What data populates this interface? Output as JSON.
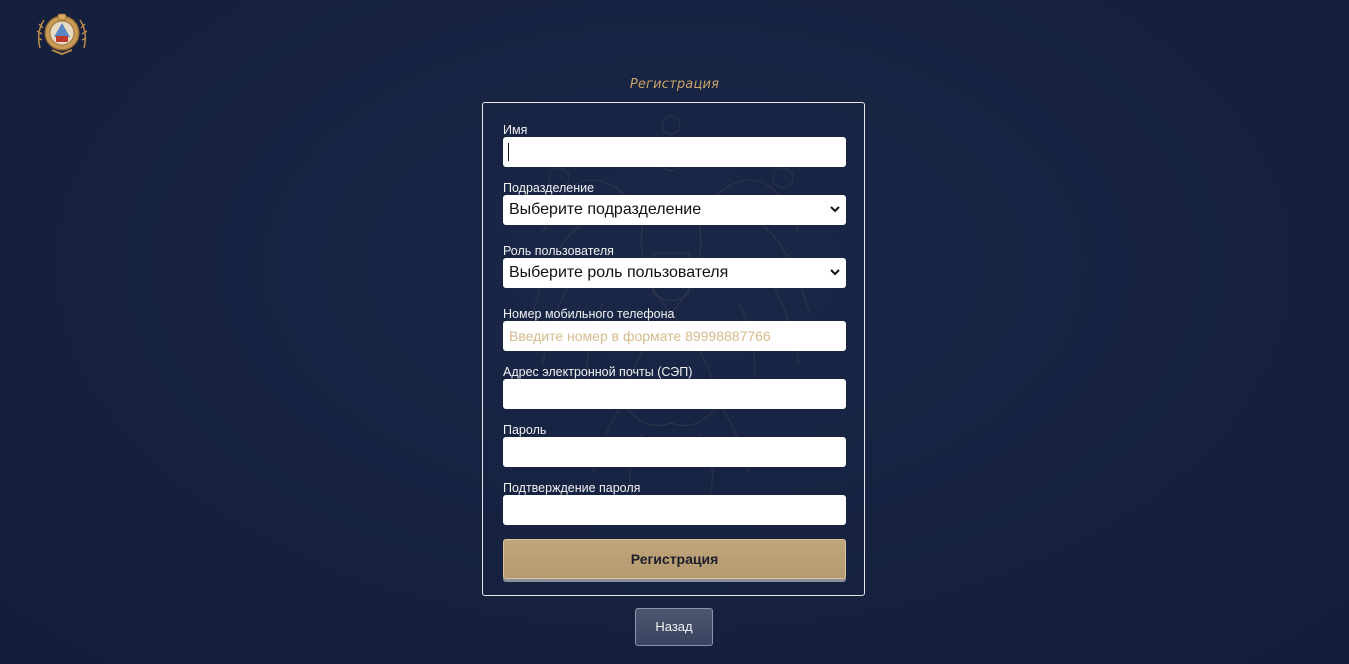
{
  "form": {
    "title": "Регистрация",
    "fields": [
      {
        "label": "Имя",
        "value": "",
        "placeholder": ""
      },
      {
        "label": "Подразделение",
        "selected": "Выберите подразделение"
      },
      {
        "label": "Роль пользователя",
        "selected": "Выберите роль пользователя"
      },
      {
        "label": "Номер мобильного телефона",
        "value": "",
        "placeholder": "Введите номер в формате 89998887766"
      },
      {
        "label": "Адрес электронной почты (СЭП)",
        "value": "",
        "placeholder": ""
      },
      {
        "label": "Пароль",
        "value": "",
        "placeholder": ""
      },
      {
        "label": "Подтверждение пароля",
        "value": "",
        "placeholder": ""
      }
    ],
    "submit_label": "Регистрация"
  },
  "back_label": "Назад",
  "icons": {
    "logo": "police-emblem-icon",
    "select_arrow": "chevron-down-icon",
    "background": "double-headed-eagle-watermark"
  },
  "colors": {
    "background": "#15213f",
    "accent_gold": "#c9a46a",
    "button_gold": "#b8a075",
    "placeholder": "#d6b98c"
  }
}
